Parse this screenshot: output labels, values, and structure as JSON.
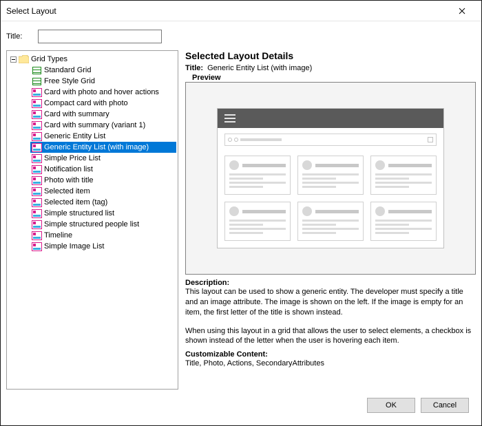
{
  "window": {
    "title": "Select Layout"
  },
  "titleField": {
    "label": "Title:",
    "value": ""
  },
  "tree": {
    "root": {
      "label": "Grid Types",
      "expanded": true
    },
    "items": [
      {
        "label": "Standard Grid",
        "icon": "grid-green"
      },
      {
        "label": "Free Style Grid",
        "icon": "grid-green"
      },
      {
        "label": "Card with photo and hover actions",
        "icon": "layout-pink"
      },
      {
        "label": "Compact card with photo",
        "icon": "layout-pink"
      },
      {
        "label": "Card with summary",
        "icon": "layout-pink"
      },
      {
        "label": "Card with summary (variant 1)",
        "icon": "layout-pink"
      },
      {
        "label": "Generic Entity List",
        "icon": "layout-pink"
      },
      {
        "label": "Generic Entity List (with image)",
        "icon": "layout-pink",
        "selected": true
      },
      {
        "label": "Simple Price List",
        "icon": "layout-pink"
      },
      {
        "label": "Notification list",
        "icon": "layout-pink"
      },
      {
        "label": "Photo with title",
        "icon": "layout-pink"
      },
      {
        "label": "Selected item",
        "icon": "layout-pink"
      },
      {
        "label": "Selected item (tag)",
        "icon": "layout-pink"
      },
      {
        "label": "Simple structured list",
        "icon": "layout-pink"
      },
      {
        "label": "Simple structured people list",
        "icon": "layout-pink"
      },
      {
        "label": "Timeline",
        "icon": "layout-pink"
      },
      {
        "label": "Simple Image List",
        "icon": "layout-pink"
      }
    ]
  },
  "details": {
    "heading": "Selected Layout Details",
    "titleLabel": "Title:",
    "titleValue": "Generic Entity List (with image)",
    "previewLabel": "Preview",
    "descLabel": "Description:",
    "descText1": "This layout can be used to show a generic entity. The developer must specify a title and an image attribute. The image is shown on the left. If the image is empty for an item, the first letter of the title is shown instead.",
    "descText2": "When using this layout in a grid that allows the user to select elements, a checkbox is shown instead of the letter when the user is hovering each item.",
    "customLabel": "Customizable Content:",
    "customText": "Title, Photo, Actions, SecondaryAttributes"
  },
  "buttons": {
    "ok": "OK",
    "cancel": "Cancel"
  }
}
